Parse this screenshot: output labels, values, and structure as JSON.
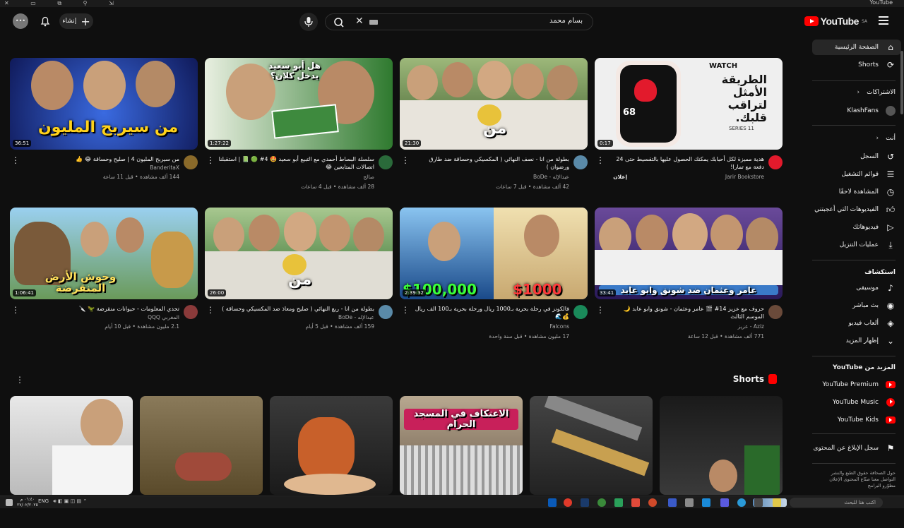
{
  "window": {
    "title": "YouTube"
  },
  "header": {
    "logo_text": "YouTube",
    "logo_region": "SA",
    "search_value": "بسام محمد",
    "create_label": "إنشاء",
    "avatar_label": "•••"
  },
  "sidebar": {
    "main_items": [
      {
        "label": "الصفحة الرئيسية",
        "icon": "home-icon"
      },
      {
        "label": "Shorts",
        "icon": "shorts-icon"
      }
    ],
    "subscriptions_header": "الاشتراكات",
    "subscriptions": [
      {
        "label": "KlashFans"
      }
    ],
    "you_header": "أنت",
    "you_items": [
      {
        "label": "السجل",
        "icon": "history-icon"
      },
      {
        "label": "قوائم التشغيل",
        "icon": "playlists-icon"
      },
      {
        "label": "المشاهدة لاحقًا",
        "icon": "watch-later-icon"
      },
      {
        "label": "الفيديوهات التي أعجبتني",
        "icon": "like-icon"
      },
      {
        "label": "فيديوهاتك",
        "icon": "your-videos-icon"
      },
      {
        "label": "عمليات التنزيل",
        "icon": "download-icon"
      }
    ],
    "explore_header": "استكشاف",
    "explore_items": [
      {
        "label": "موسيقى",
        "icon": "music-icon"
      },
      {
        "label": "بث مباشر",
        "icon": "live-icon"
      },
      {
        "label": "ألعاب فيديو",
        "icon": "gaming-icon"
      },
      {
        "label": "إظهار المزيد",
        "icon": "chevron-down-icon"
      }
    ],
    "more_header": "المزيد من YouTube",
    "more_items": [
      {
        "label": "YouTube Premium"
      },
      {
        "label": "YouTube Music"
      },
      {
        "label": "YouTube Kids"
      }
    ],
    "report_label": "سجل الإبلاغ عن المحتوى",
    "footer_lines": [
      "حول  الصحافة  حقوق الطبع والنشر",
      "التواصل معنا  صنّاع المحتوى  الإعلان",
      "مطوّرو البرامج"
    ]
  },
  "videos": [
    {
      "duration": "0:17",
      "title": "هدية مميزة لكل أحبابك يمكنك الحصول عليها بالتقسيط حتى 24 دفعة مع تمارا!",
      "channel": "Jarir Bookstore",
      "stats": "إعلان",
      "overlay": "الطريقة الأمثل لتراقب قلبك.",
      "thumb_bg": "#efefef"
    },
    {
      "duration": "21:30",
      "title": "بطولة من انا - نصف النهائي ( المكسيكي وحساقة ضد طارق ورضوان )",
      "channel": "عبدالإله - BoDe",
      "stats": "42 ألف مشاهدة • قبل 7 ساعات",
      "overlay": "من",
      "thumb_bg": "#3a5a2a"
    },
    {
      "duration": "1:27:22",
      "title": "سلسلة البساط أحمدي مع التبيع أبو سعيد 🤩 4# 🟢 📗 | استقبلنا اتصالات المتابعين 😂",
      "channel": "صالح",
      "stats": "28 ألف مشاهدة • قبل 4 ساعات",
      "overlay": "هل أبو سعيد يدخل كلان؟",
      "thumb_bg": "#2f7a2f"
    },
    {
      "duration": "36:51",
      "title": "من سيربح المليون 4 | صليح وحساقة 😂 👍",
      "channel": "BanderitaX",
      "stats": "144 ألف مشاهدة • قبل 11 ساعة",
      "overlay": "من سيربح المليون",
      "thumb_bg": "#1c2a7a"
    },
    {
      "duration": "33:41",
      "title": "حروف مع عزيز 14# 🎬 عامر وعثمان - شونق وابو عابد 🌙 الموسم الثالث",
      "channel": "Aziz - عزيز",
      "stats": "771 ألف مشاهدة • قبل 12 ساعة",
      "overlay": "عامر وعثمان ضد شونق وابو عابد",
      "thumb_bg": "#5a3a7a"
    },
    {
      "duration": "2:39:32",
      "title": "فالكونز في رحلة بحرية بـ1000 ريال ورحلة بحرية بـ100 الف ريال 💰🌊",
      "channel": "Falcons",
      "stats": "17 مليون مشاهدة • قبل سنة واحدة",
      "overlay": "$1000",
      "overlay2": "$100,000",
      "thumb_bg": "#3a7ab8"
    },
    {
      "duration": "26:00",
      "title": "بطولة من انا - ربع النهائي ( صليح ومعاذ ضد المكسيكي وحساقة )",
      "channel": "عبدالإله - BoDe",
      "stats": "159 ألف مشاهدة • قبل 5 أيام",
      "overlay": "من",
      "thumb_bg": "#2f6a2a"
    },
    {
      "duration": "1:06:41",
      "title": "تحدي المعلومات - حيوانات منقرضة 🦖 🔪",
      "channel": "المغربي QQQ",
      "stats": "2.1 مليون مشاهدة • قبل 10 أيام",
      "overlay": "وحوش الأرض المنقرضة",
      "thumb_bg": "#4a8ab0"
    }
  ],
  "shorts": {
    "title": "Shorts",
    "items": [
      {
        "overlay": "",
        "bg": "#3a3a3a"
      },
      {
        "overlay": "الاعتكاف في المسجد الحرام",
        "bg": "#8a7a6a"
      },
      {
        "overlay": "",
        "bg": "#3a3a3a"
      },
      {
        "overlay": "",
        "bg": "#6a5a3a"
      },
      {
        "overlay": "",
        "bg": "#6a5a3a"
      },
      {
        "overlay": "",
        "bg": "#ddd"
      }
    ]
  },
  "taskbar": {
    "search_placeholder": "اكتب هنا للبحث",
    "time": "٠٦:٤٠ م",
    "date": "٢٧/٠٢/٢٠٢٥",
    "lang": "ENG"
  }
}
